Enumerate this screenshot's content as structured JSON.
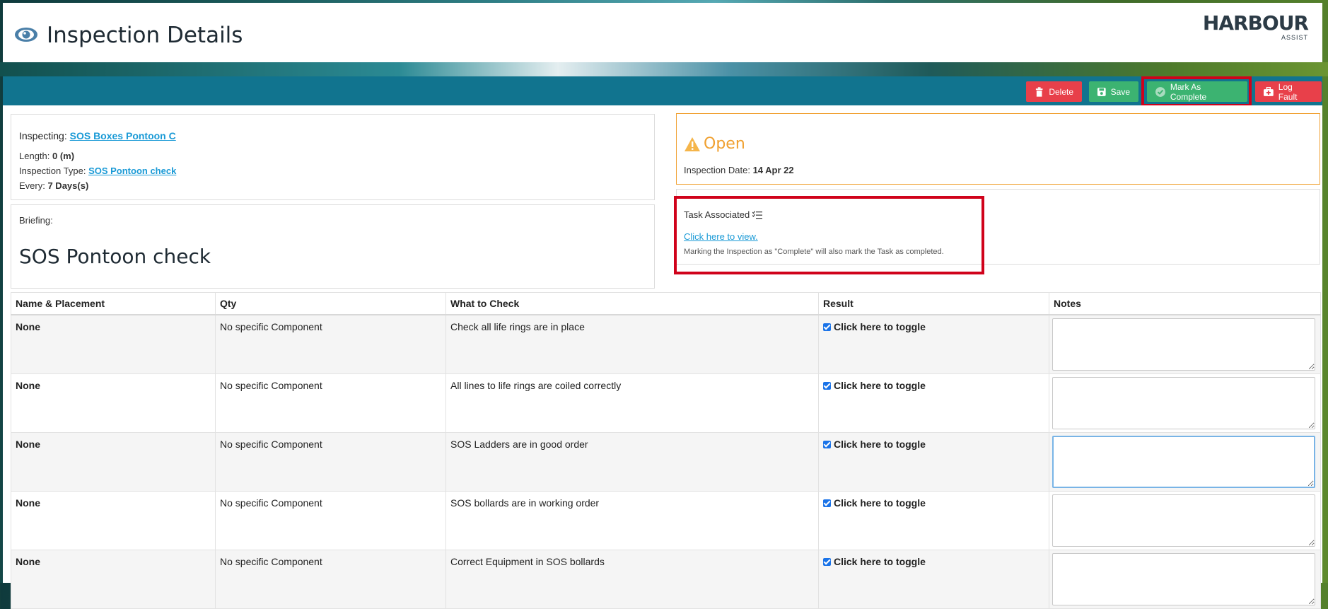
{
  "header": {
    "title": "Inspection Details",
    "logo_main": "HARBOUR",
    "logo_sub": "ASSIST"
  },
  "toolbar": {
    "delete_label": "Delete",
    "save_label": "Save",
    "complete_label": "Mark As Complete",
    "fault_label": "Log Fault"
  },
  "details": {
    "inspecting_label": "Inspecting:",
    "inspecting_value": "SOS Boxes Pontoon C",
    "length_label": "Length:",
    "length_value": "0 (m)",
    "type_label": "Inspection Type:",
    "type_value": "SOS Pontoon check",
    "every_label": "Every:",
    "every_value": "7 Days(s)"
  },
  "briefing": {
    "label": "Briefing:",
    "text": "SOS Pontoon check"
  },
  "status": {
    "label": "Open",
    "date_label": "Inspection Date:",
    "date_value": "14 Apr 22"
  },
  "task": {
    "label": "Task Associated",
    "link": "Click here to view.",
    "note": "Marking the Inspection as \"Complete\" will also mark the Task as completed."
  },
  "table": {
    "headers": [
      "Name & Placement",
      "Qty",
      "What to Check",
      "Result",
      "Notes"
    ],
    "rows": [
      {
        "name": "None",
        "qty": "No specific Component",
        "check": "Check all life rings are in place",
        "result": "Click here to toggle",
        "notes": ""
      },
      {
        "name": "None",
        "qty": "No specific Component",
        "check": "All lines to life rings are coiled correctly",
        "result": "Click here to toggle",
        "notes": ""
      },
      {
        "name": "None",
        "qty": "No specific Component",
        "check": "SOS Ladders are in good order",
        "result": "Click here to toggle",
        "notes": ""
      },
      {
        "name": "None",
        "qty": "No specific Component",
        "check": "SOS bollards are in working order",
        "result": "Click here to toggle",
        "notes": ""
      },
      {
        "name": "None",
        "qty": "No specific Component",
        "check": "Correct Equipment in SOS bollards",
        "result": "Click here to toggle",
        "notes": ""
      }
    ]
  },
  "colors": {
    "toolbar": "#11748f",
    "danger": "#e8404a",
    "success": "#3cb371",
    "warning": "#f0a030",
    "highlight": "#d0021b",
    "link": "#1a9ad6"
  }
}
